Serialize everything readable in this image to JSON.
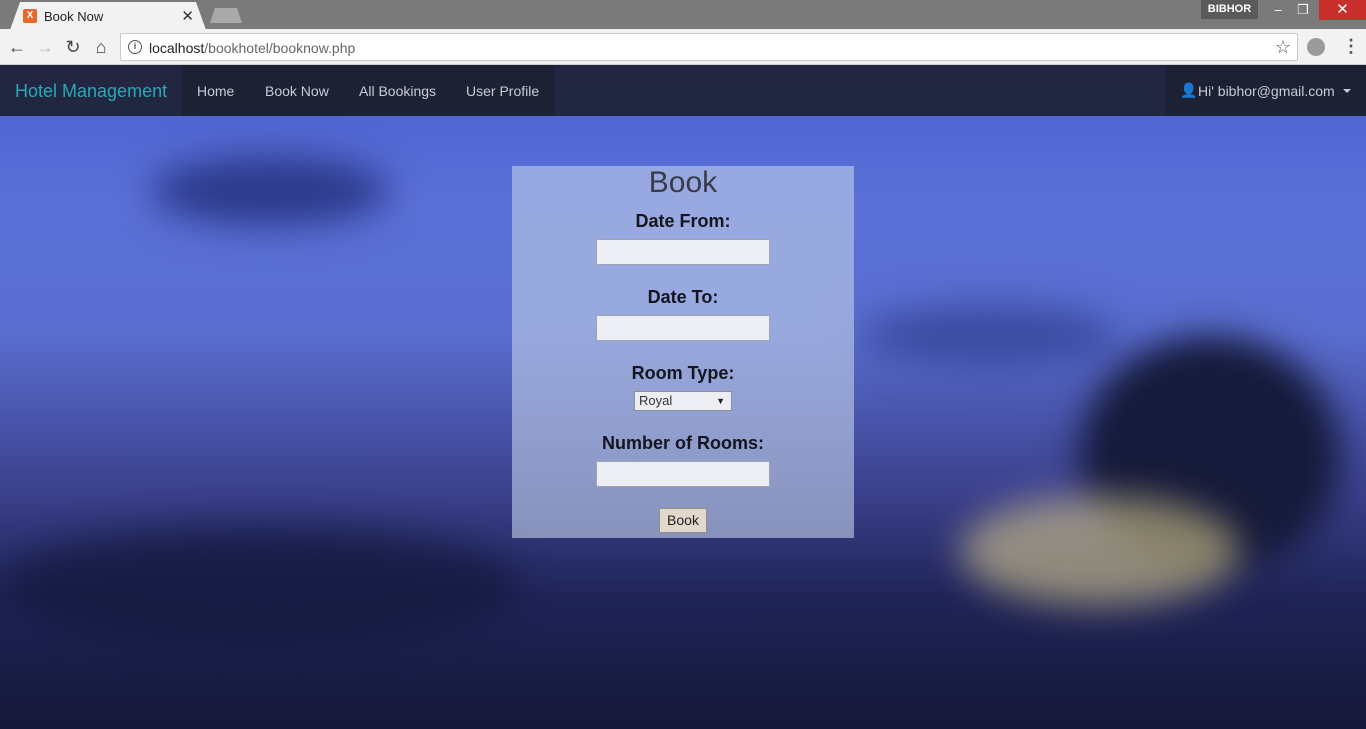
{
  "browser": {
    "tab_title": "Book Now",
    "profile": "BIBHOR",
    "url_host": "localhost",
    "url_path": "/bookhotel/booknow.php"
  },
  "navbar": {
    "brand": "Hotel Management",
    "links": [
      "Home",
      "Book Now",
      "All Bookings",
      "User Profile"
    ],
    "user_label": "Hi' bibhor@gmail.com"
  },
  "form": {
    "title": "Book",
    "date_from_label": "Date From:",
    "date_from_value": "",
    "date_to_label": "Date To:",
    "date_to_value": "",
    "room_type_label": "Room Type:",
    "room_type_value": "Royal",
    "rooms_label": "Number of Rooms:",
    "rooms_value": "",
    "submit_label": "Book"
  },
  "colors": {
    "brand": "#2aa8b8",
    "navbar_bg": "#1c2233"
  }
}
